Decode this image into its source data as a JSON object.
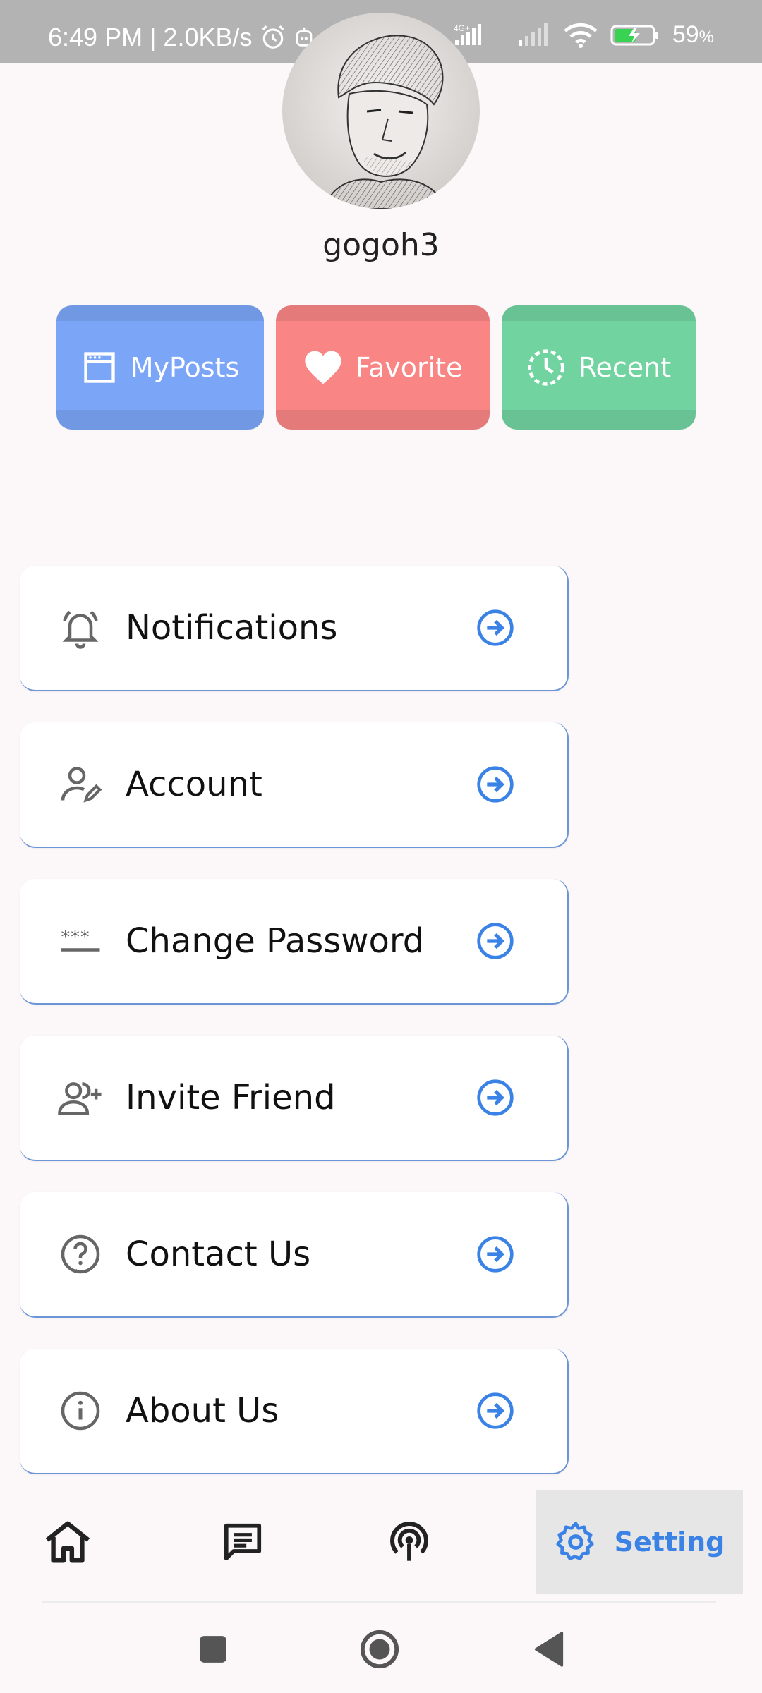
{
  "status_bar": {
    "time_speed": "6:49 PM | 2.0KB/s",
    "network": "4G+",
    "battery": "59",
    "battery_unit": "%"
  },
  "profile": {
    "username": "gogoh3"
  },
  "quick_actions": [
    {
      "label": "MyPosts",
      "icon": "window-icon",
      "color": "#7ba6f7"
    },
    {
      "label": "Favorite",
      "icon": "heart-icon",
      "color": "#f98585"
    },
    {
      "label": "Recent",
      "icon": "clock-icon",
      "color": "#71d3a0"
    }
  ],
  "settings": [
    {
      "label": "Notifications",
      "icon": "bell-icon"
    },
    {
      "label": "Account",
      "icon": "user-edit-icon"
    },
    {
      "label": "Change Password",
      "icon": "password-icon"
    },
    {
      "label": "Invite Friend",
      "icon": "add-friend-icon"
    },
    {
      "label": "Contact Us",
      "icon": "help-icon"
    },
    {
      "label": "About Us",
      "icon": "info-icon"
    }
  ],
  "bottom_nav": {
    "items": [
      "home-icon",
      "chat-icon",
      "broadcast-icon",
      "gear-icon"
    ],
    "active_label": "Setting",
    "accent": "#3b82e6"
  }
}
